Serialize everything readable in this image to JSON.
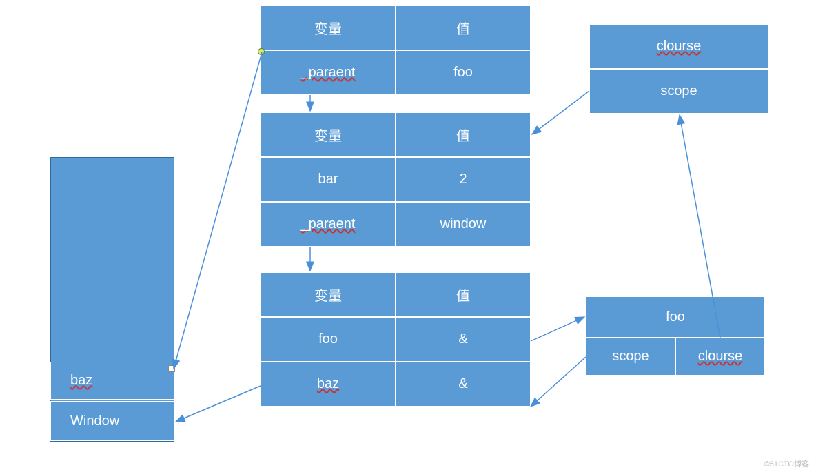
{
  "colors": {
    "box_fill": "#5B9BD5",
    "box_border": "#2E6B9E",
    "cell_border": "#ffffff",
    "text": "#ffffff",
    "arrow": "#4A90D9",
    "underline": "#cc3333"
  },
  "tables": {
    "top": {
      "rows": [
        {
          "variable": "变量",
          "value": "值"
        },
        {
          "variable": "_paraent",
          "value": "foo"
        }
      ]
    },
    "middle": {
      "rows": [
        {
          "variable": "变量",
          "value": "值"
        },
        {
          "variable": "bar",
          "value": "2"
        },
        {
          "variable": "_paraent",
          "value": "window"
        }
      ]
    },
    "bottom": {
      "rows": [
        {
          "variable": "变量",
          "value": "值"
        },
        {
          "variable": "foo",
          "value": "&"
        },
        {
          "variable": "baz",
          "value": "&"
        }
      ]
    }
  },
  "left_box": {
    "baz": "baz",
    "window": "Window"
  },
  "right_top": {
    "title": "clourse",
    "row": "scope"
  },
  "right_bottom": {
    "title": "foo",
    "left": "scope",
    "right": "clourse"
  },
  "watermark": "©51CTO博客"
}
